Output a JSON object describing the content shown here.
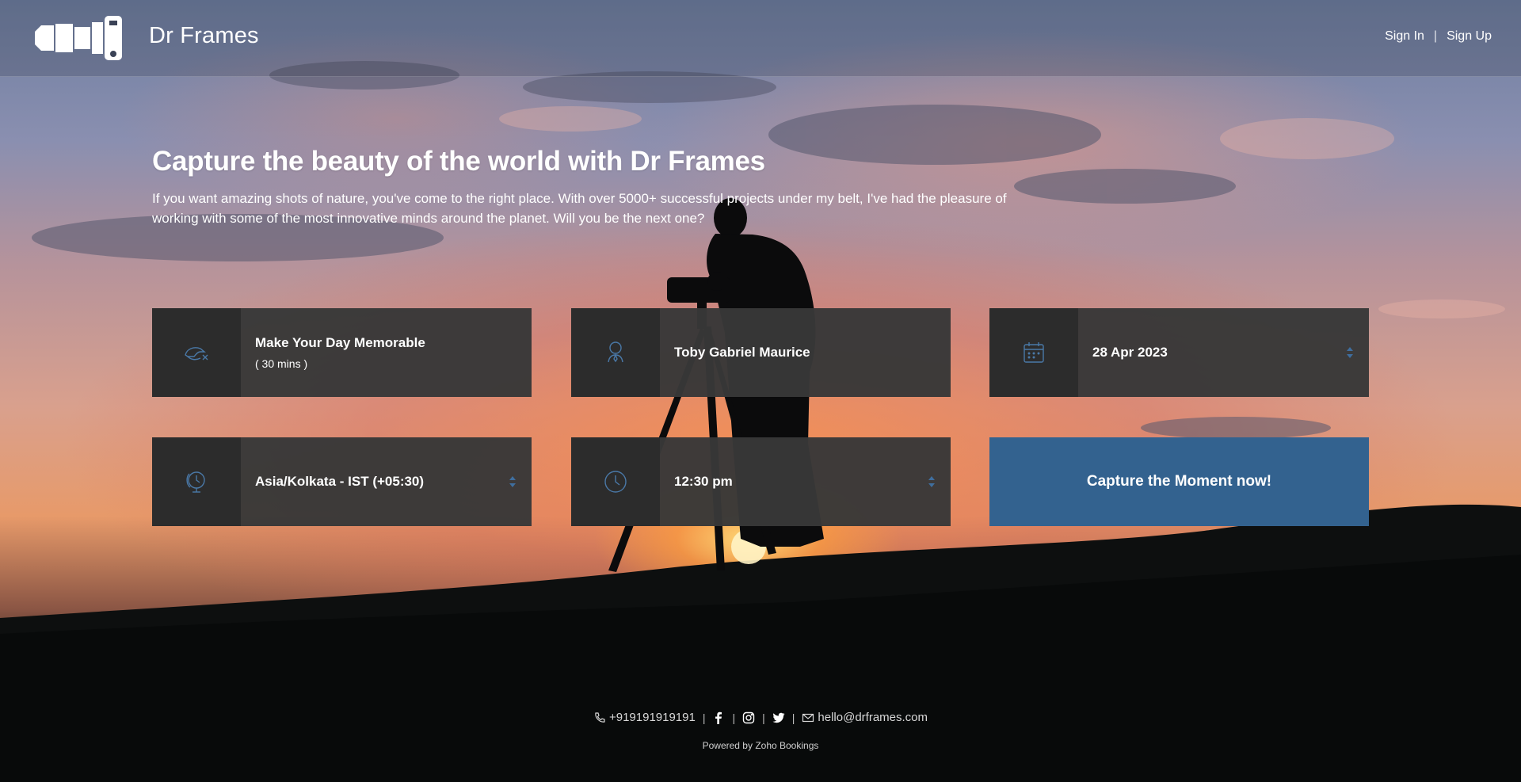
{
  "header": {
    "brand": "Dr Frames",
    "sign_in": "Sign In",
    "separator": "|",
    "sign_up": "Sign Up"
  },
  "hero": {
    "title": "Capture the beauty of the world with Dr Frames",
    "description": "If you want amazing shots of nature, you've come to the right place. With over 5000+ successful projects under my belt, I've had the pleasure of working with some of the most innovative minds around the planet. Will you be the next one?"
  },
  "booking": {
    "service": {
      "name": "Make Your Day Memorable",
      "duration": "( 30 mins )",
      "icon": "service-icon"
    },
    "staff": {
      "name": "Toby Gabriel Maurice",
      "icon": "user-icon"
    },
    "date": {
      "value": "28 Apr 2023",
      "icon": "calendar-icon"
    },
    "timezone": {
      "value": "Asia/Kolkata - IST (+05:30)",
      "icon": "globe-clock-icon"
    },
    "time": {
      "value": "12:30 pm",
      "icon": "clock-icon"
    },
    "cta": "Capture the Moment now!"
  },
  "footer": {
    "phone": "+919191919191",
    "email": "hello@drframes.com",
    "powered_by": "Powered by Zoho Bookings",
    "social": [
      "facebook-icon",
      "instagram-icon",
      "twitter-icon"
    ]
  },
  "colors": {
    "accent": "#33628f",
    "card_bg": "#383838",
    "icon_bg": "#2c2c2c",
    "icon_color": "#4a79a8"
  }
}
